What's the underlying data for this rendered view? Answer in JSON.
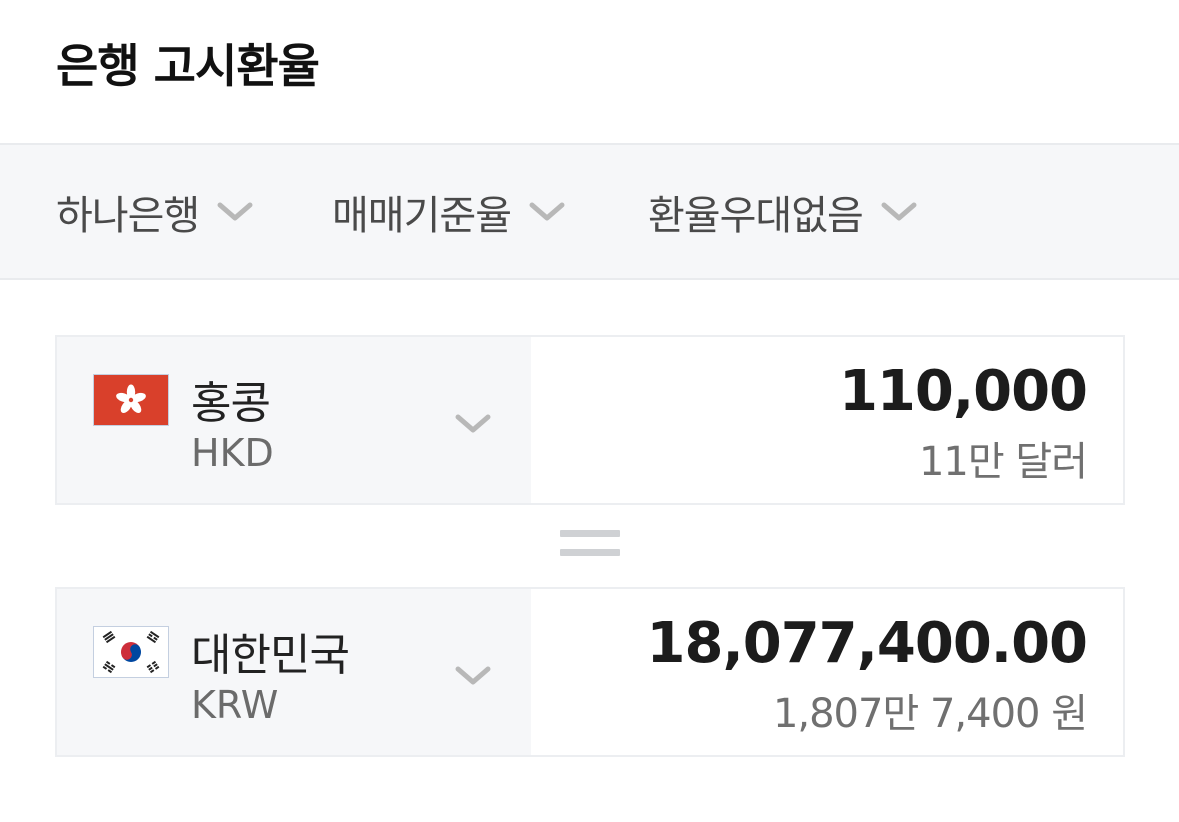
{
  "header": {
    "title": "은행 고시환율"
  },
  "filters": [
    {
      "label": "하나은행",
      "icon": "chevron-down-icon"
    },
    {
      "label": "매매기준율",
      "icon": "chevron-down-icon"
    },
    {
      "label": "환율우대없음",
      "icon": "chevron-down-icon"
    }
  ],
  "from": {
    "country": "홍콩",
    "code": "HKD",
    "amount": "110,000",
    "amount_text": "11만 달러",
    "flag_icon": "hong-kong-flag-icon"
  },
  "to": {
    "country": "대한민국",
    "code": "KRW",
    "amount": "18,077,400.00",
    "amount_text": "1,807만 7,400 원",
    "flag_icon": "south-korea-flag-icon"
  },
  "colors": {
    "hk_red": "#d9402b",
    "kr_red": "#cd2e3a",
    "kr_blue": "#0047a0",
    "filter_bg": "#f6f7f9",
    "chevron": "#b8b8b8"
  }
}
